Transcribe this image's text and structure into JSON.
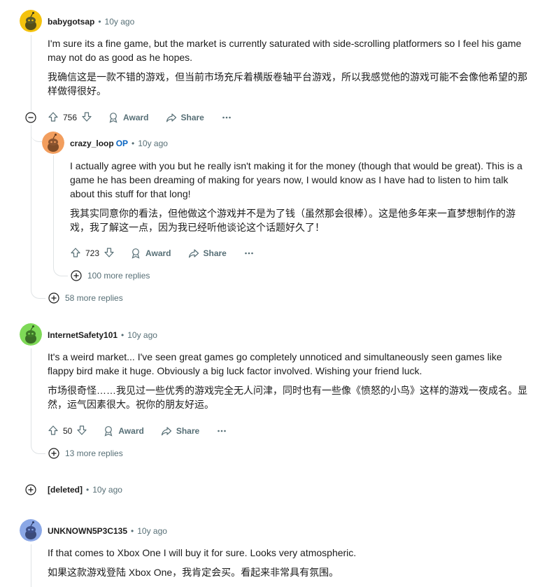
{
  "comments": [
    {
      "user": "babygotsap",
      "time": "10y ago",
      "avatar_color": "#f4c20d",
      "text_en": "I'm sure its a fine game, but the market is currently saturated with side-scrolling platformers so I feel his game may not do as good as he hopes.",
      "text_zh": "我确信这是一款不错的游戏，但当前市场充斥着横版卷轴平台游戏，所以我感觉他的游戏可能不会像他希望的那样做得很好。",
      "votes": "756",
      "award_label": "Award",
      "share_label": "Share",
      "more_replies": "58 more replies"
    },
    {
      "user": "crazy_loop",
      "op_badge": "OP",
      "time": "10y ago",
      "avatar_color": "#f29e5e",
      "text_en": "I actually agree with you but he really isn't making it for the money (though that would be great). This is a game he has been dreaming of making for years now, I would know as I have had to listen to him talk about this stuff for that long!",
      "text_zh": "我其实同意你的看法，但他做这个游戏并不是为了钱（虽然那会很棒）。这是他多年来一直梦想制作的游戏，我了解这一点，因为我已经听他谈论这个话题好久了！",
      "votes": "723",
      "award_label": "Award",
      "share_label": "Share",
      "more_replies": "100 more replies"
    },
    {
      "user": "InternetSafety101",
      "time": "10y ago",
      "avatar_color": "#7ed957",
      "text_en": "It's a weird market... I've seen great games go completely unnoticed and simultaneously seen games like flappy bird make it huge. Obviously a big luck factor involved. Wishing your friend luck.",
      "text_zh": "市场很奇怪……我见过一些优秀的游戏完全无人问津，同时也有一些像《愤怒的小鸟》这样的游戏一夜成名。显然，运气因素很大。祝你的朋友好运。",
      "votes": "50",
      "award_label": "Award",
      "share_label": "Share",
      "more_replies": "13 more replies"
    },
    {
      "user": "[deleted]",
      "time": "10y ago"
    },
    {
      "user": "UNKNOWN5P3C135",
      "time": "10y ago",
      "avatar_color": "#8aa7e6",
      "text_en": "If that comes to Xbox One I will buy it for sure. Looks very atmospheric.",
      "text_zh": "如果这款游戏登陆 Xbox One，我肯定会买。看起来非常具有氛围。"
    }
  ],
  "icons": {
    "upvote": "arrow-up-icon",
    "downvote": "arrow-down-icon",
    "award": "award-icon",
    "share": "share-icon",
    "more": "ellipsis-icon",
    "collapse": "minus-circle-icon",
    "expand": "plus-circle-icon"
  }
}
